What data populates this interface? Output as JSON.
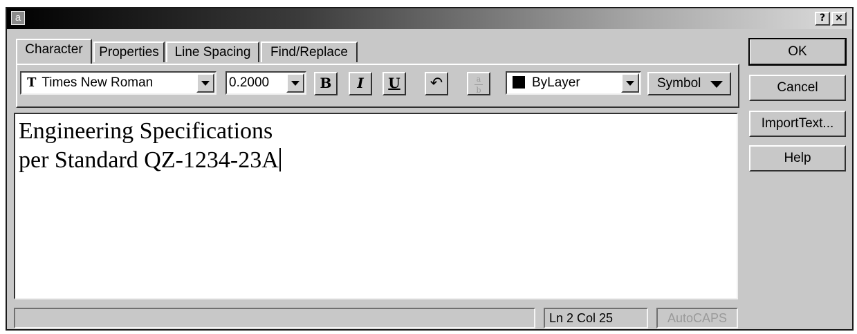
{
  "window": {
    "app_icon_glyph": "a",
    "help_button": "?",
    "close_button": "×"
  },
  "tabs": [
    {
      "label": "Character",
      "active": true
    },
    {
      "label": "Properties",
      "active": false
    },
    {
      "label": "Line Spacing",
      "active": false
    },
    {
      "label": "Find/Replace",
      "active": false
    }
  ],
  "toolbar": {
    "font_glyph": "T",
    "font_value": "Times New Roman",
    "height_value": "0.2000",
    "bold_label": "B",
    "italic_label": "I",
    "underline_label": "U",
    "undo_glyph": "↶",
    "stack_top": "a",
    "stack_bottom": "b",
    "color_value": "ByLayer",
    "color_swatch": "#000000",
    "symbol_label": "Symbol"
  },
  "editor": {
    "lines": [
      "Engineering Specifications",
      "per Standard QZ-1234-23A"
    ]
  },
  "status": {
    "message": "",
    "position": "Ln 2 Col 25",
    "autocaps": "AutoCAPS"
  },
  "buttons": {
    "ok": "OK",
    "cancel": "Cancel",
    "import": "ImportText...",
    "help": "Help"
  }
}
